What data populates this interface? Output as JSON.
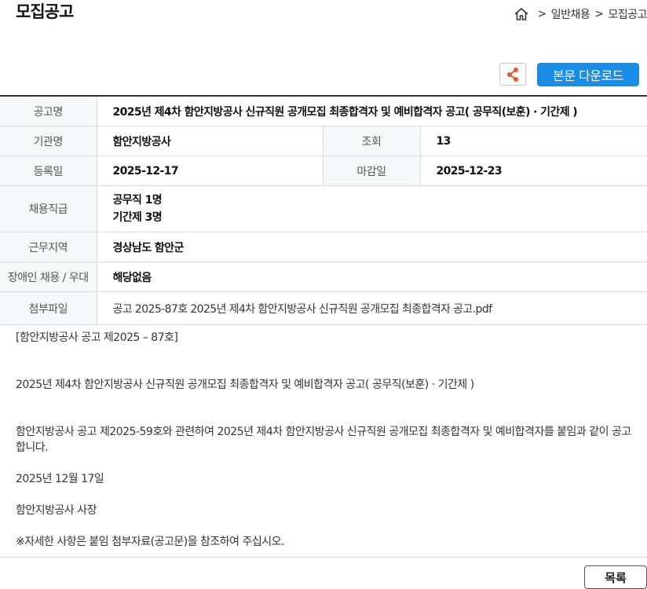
{
  "header": {
    "title": "모집공고",
    "breadcrumb": [
      "일반채용",
      "모집공고"
    ],
    "breadcrumb_sep": ">"
  },
  "actions": {
    "share_icon": "share-icon",
    "download_label": "본문 다운로드"
  },
  "info": {
    "title_label": "공고명",
    "title_value": "2025년 제4차 함안지방공사 신규직원 공개모집 최종합격자 및 예비합격자 공고( 공무직(보훈) · 기간제 )",
    "org_label": "기관명",
    "org_value": "함안지방공사",
    "views_label": "조회",
    "views_value": "13",
    "reg_label": "등록일",
    "reg_value": "2025-12-17",
    "deadline_label": "마감일",
    "deadline_value": "2025-12-23",
    "positions_label": "채용직급",
    "positions": [
      "공무직 1명",
      "기간제 3명"
    ],
    "region_label": "근무지역",
    "region_value": "경상남도 함안군",
    "disabled_label": "장애인 채용 / 우대",
    "disabled_value": "해당없음",
    "attach_label": "첨부파일",
    "attach_value": "공고 2025-87호 2025년 제4차 함안지방공사 신규직원 공개모집 최종합격자 공고.pdf"
  },
  "body": {
    "notice_no": "[함안지방공사 공고 제2025 – 87호]",
    "headline": "2025년 제4차 함안지방공사 신규직원 공개모집 최종합격자 및 예비합격자 공고( 공무직(보훈) · 기간제 )",
    "paragraph": "함안지방공사 공고 제2025-59호와 관련하여 2025년 제4차 함안지방공사 신규직원 공개모집 최종합격자 및 예비합격자를 붙임과 같이 공고합니다.",
    "date": "2025년 12월 17일",
    "signer": "함안지방공사 사장",
    "note": "※자세한 사항은 붙임 첨부자료(공고문)을 참조하여 주십시오."
  },
  "footer": {
    "list_label": "목록"
  },
  "colors": {
    "accent": "#1a8ee6",
    "share_icon": "#e8572e"
  }
}
